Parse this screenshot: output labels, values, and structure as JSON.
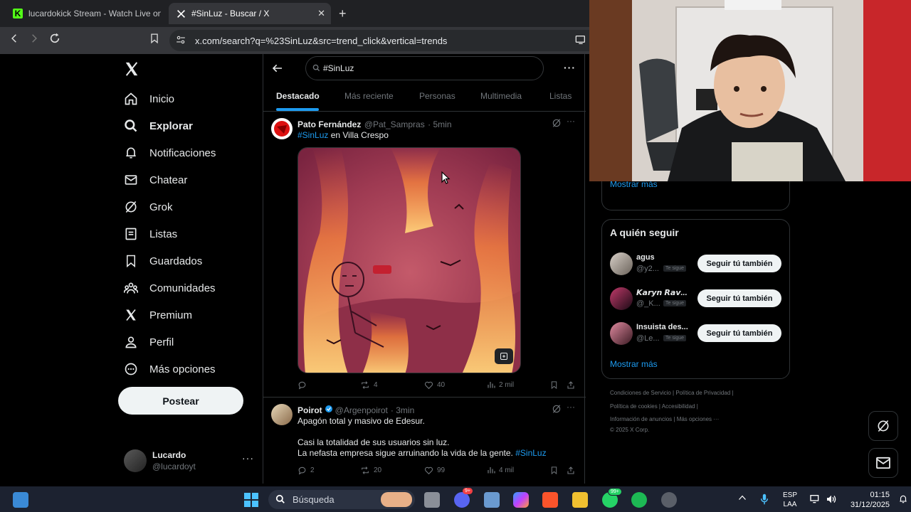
{
  "browser": {
    "tabs": [
      {
        "title": "lucardokick Stream - Watch Live on K",
        "favicon": "kick-icon",
        "active": false
      },
      {
        "title": "#SinLuz - Buscar / X",
        "favicon": "x-icon",
        "active": true
      }
    ],
    "url": "x.com/search?q=%23SinLuz&src=trend_click&vertical=trends"
  },
  "sidebar": {
    "items": [
      {
        "label": "Inicio",
        "icon": "home-icon"
      },
      {
        "label": "Explorar",
        "icon": "search-icon"
      },
      {
        "label": "Notificaciones",
        "icon": "bell-icon"
      },
      {
        "label": "Chatear",
        "icon": "mail-icon"
      },
      {
        "label": "Grok",
        "icon": "grok-icon"
      },
      {
        "label": "Listas",
        "icon": "list-icon"
      },
      {
        "label": "Guardados",
        "icon": "bookmark-icon"
      },
      {
        "label": "Comunidades",
        "icon": "communities-icon"
      },
      {
        "label": "Premium",
        "icon": "x-icon"
      },
      {
        "label": "Perfil",
        "icon": "person-icon"
      },
      {
        "label": "Más opciones",
        "icon": "more-circle-icon"
      }
    ],
    "post_button": "Postear",
    "user": {
      "name": "Lucardo",
      "handle": "@lucardoyt"
    }
  },
  "search": {
    "query": "#SinLuz",
    "tabs": [
      "Destacado",
      "Más reciente",
      "Personas",
      "Multimedia",
      "Listas"
    ]
  },
  "tweets": [
    {
      "name": "Pato Fernández",
      "handle": "@Pat_Sampras",
      "time": "· 5min",
      "hashtag": "#SinLuz",
      "text_rest": " en Villa Crespo",
      "stats": {
        "replies": "",
        "retweets": "4",
        "likes": "40",
        "views": "2 mil"
      }
    },
    {
      "name": "Poirot",
      "handle": "@Argenpoirot",
      "time": "· 3min",
      "line1": "Apagón total y masivo de Edesur.",
      "line2": "Casi la totalidad de sus usuarios sin luz.",
      "line3": "La nefasta empresa sigue arruinando la vida de la gente.",
      "hashtag": "#SinLuz",
      "stats": {
        "replies": "2",
        "retweets": "20",
        "likes": "99",
        "views": "4 mil"
      }
    }
  ],
  "right": {
    "show_more_1": "Mostrar más",
    "who_to_follow_title": "A quién seguir",
    "follow_suggestions": [
      {
        "name": "agus",
        "handle": "@y2...",
        "badge": "Te sigue",
        "button": "Seguir tú también"
      },
      {
        "name": "𝙆𝙖𝙧𝙮𝙣 𝙍𝙖𝙫...",
        "handle": "@_K...",
        "badge": "Te sigue",
        "button": "Seguir tú también"
      },
      {
        "name": "Insuista des...",
        "handle": "@Le...",
        "badge": "Te sigue",
        "button": "Seguir tú también"
      }
    ],
    "show_more_2": "Mostrar más",
    "footer": {
      "line1": "Condiciones de Servicio  |  Política de Privacidad  |",
      "line2": "Política de cookies  |  Accesibilidad  |",
      "line3": "Información de anuncios  |  Más opciones ···",
      "line4": "© 2025 X Corp."
    }
  },
  "taskbar": {
    "search_placeholder": "Búsqueda",
    "lang_top": "ESP",
    "lang_bottom": "LAA",
    "time": "01:15",
    "date": "31/12/2025",
    "badges": {
      "discord": "9+",
      "whatsapp": "99+"
    }
  },
  "colors": {
    "accent": "#1d9bf0",
    "background": "#000000",
    "border": "#2f3336",
    "muted": "#71767b"
  }
}
